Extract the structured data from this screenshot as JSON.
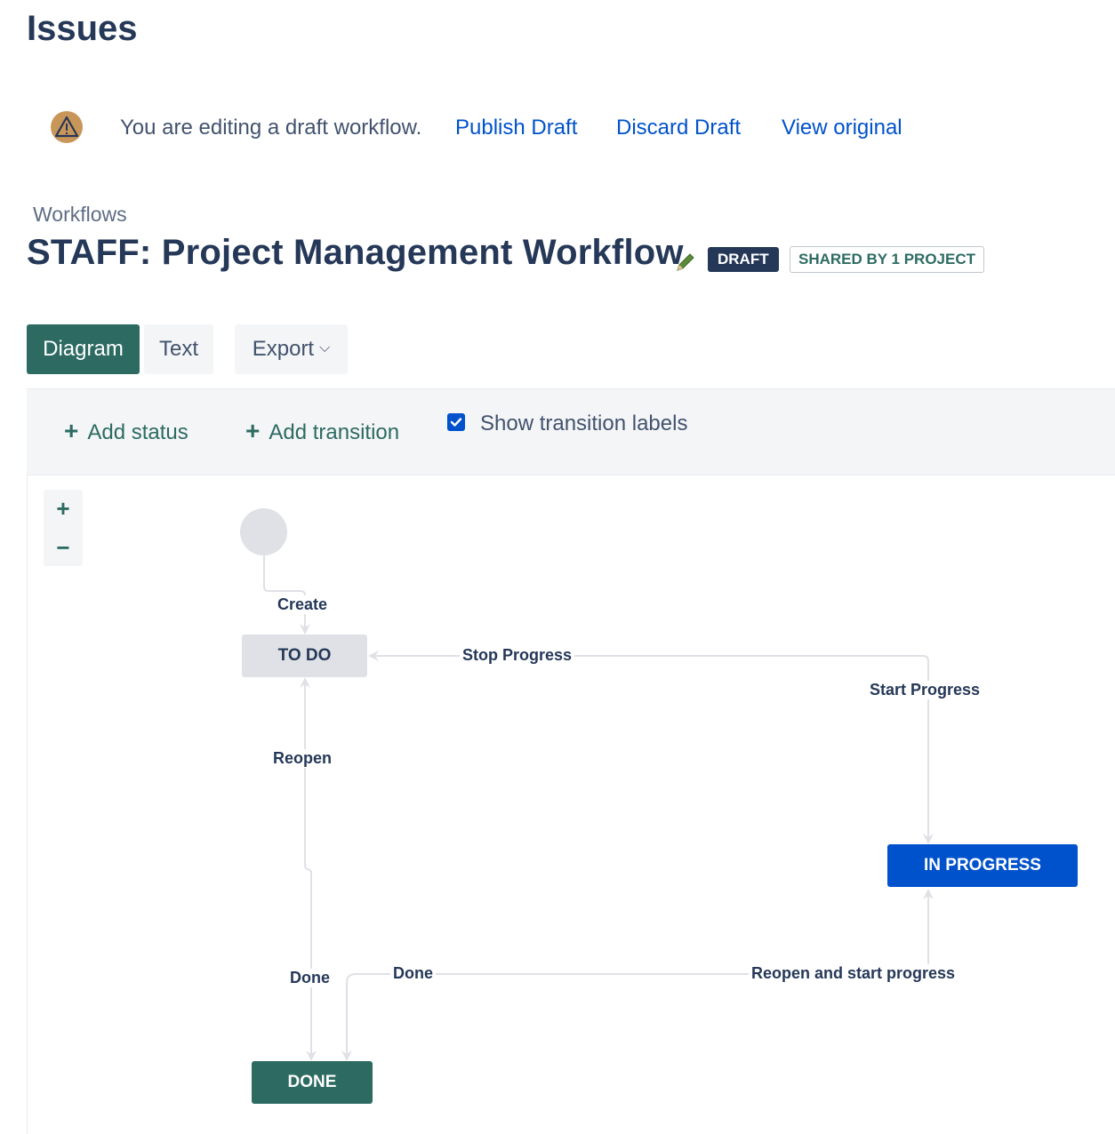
{
  "page": {
    "title": "Issues"
  },
  "banner": {
    "message": "You are editing a draft workflow.",
    "publish_label": "Publish Draft",
    "discard_label": "Discard Draft",
    "view_original_label": "View original",
    "icon": "warning-icon"
  },
  "header": {
    "breadcrumb": "Workflows",
    "title": "STAFF: Project Management Workflow",
    "draft_badge": "DRAFT",
    "shared_badge": "SHARED BY 1 PROJECT"
  },
  "tabs": {
    "diagram": "Diagram",
    "text": "Text",
    "export": "Export"
  },
  "toolbar": {
    "add_status": "Add status",
    "add_transition": "Add transition",
    "show_labels": "Show transition labels",
    "show_labels_checked": true
  },
  "zoom": {
    "in": "+",
    "out": "−"
  },
  "diagram": {
    "statuses": {
      "todo": "TO DO",
      "in_progress": "IN PROGRESS",
      "done": "DONE"
    },
    "transitions": {
      "create": "Create",
      "stop_progress": "Stop Progress",
      "start_progress": "Start Progress",
      "reopen": "Reopen",
      "done_left": "Done",
      "done_mid": "Done",
      "reopen_start": "Reopen and start progress"
    }
  },
  "colors": {
    "primary": "#2d6b62",
    "link": "#0052cc",
    "in_progress": "#0052cc",
    "todo": "#dfe1e6",
    "dark": "#253858"
  }
}
